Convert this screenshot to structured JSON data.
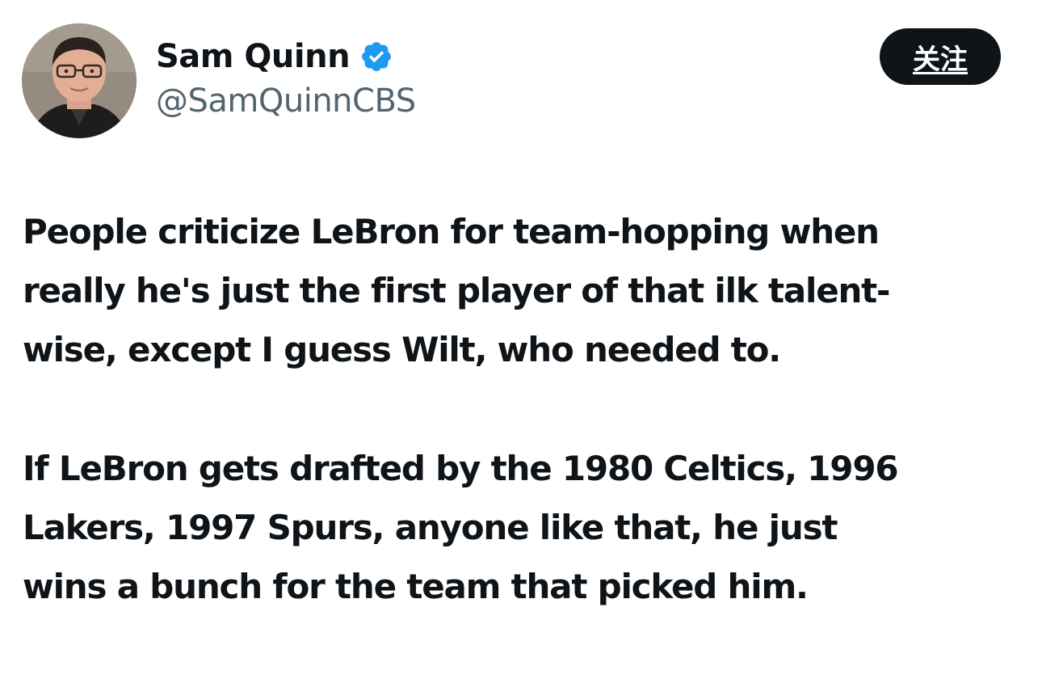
{
  "author": {
    "display_name": "Sam Quinn",
    "handle": "@SamQuinnCBS",
    "verified": true,
    "verified_badge_icon": "verified-badge-icon",
    "verified_color": "#1d9bf0"
  },
  "actions": {
    "follow_label": "关注"
  },
  "tweet": {
    "paragraphs": [
      "People criticize LeBron for team-hopping when\nreally he's just the first player of that ilk talent-\nwise, except I guess Wilt, who needed to.",
      "If LeBron gets drafted by the 1980 Celtics, 1996\nLakers, 1997 Spurs, anyone like that, he just\nwins a bunch for the team that picked him."
    ]
  },
  "colors": {
    "text_primary": "#0f1419",
    "text_secondary": "#536471",
    "button_bg": "#0f1419",
    "button_text": "#ffffff",
    "background": "#ffffff"
  }
}
